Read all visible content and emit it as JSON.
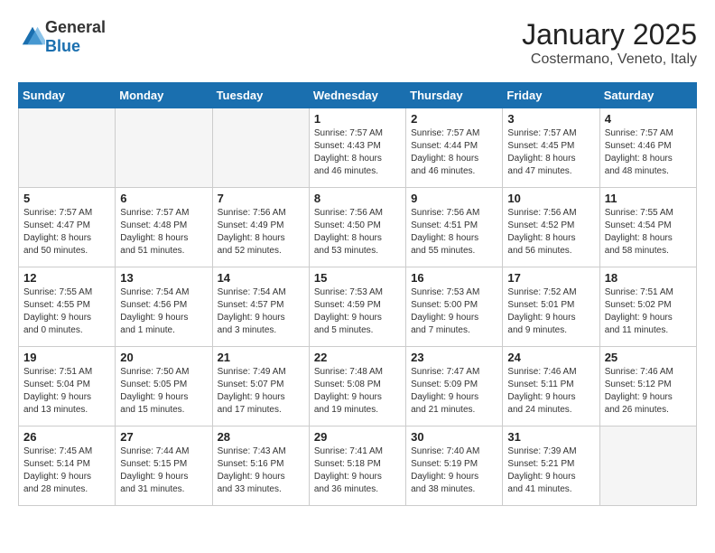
{
  "header": {
    "logo": {
      "general": "General",
      "blue": "Blue"
    },
    "month": "January 2025",
    "location": "Costermano, Veneto, Italy"
  },
  "weekdays": [
    "Sunday",
    "Monday",
    "Tuesday",
    "Wednesday",
    "Thursday",
    "Friday",
    "Saturday"
  ],
  "weeks": [
    [
      {
        "day": "",
        "info": ""
      },
      {
        "day": "",
        "info": ""
      },
      {
        "day": "",
        "info": ""
      },
      {
        "day": "1",
        "info": "Sunrise: 7:57 AM\nSunset: 4:43 PM\nDaylight: 8 hours\nand 46 minutes."
      },
      {
        "day": "2",
        "info": "Sunrise: 7:57 AM\nSunset: 4:44 PM\nDaylight: 8 hours\nand 46 minutes."
      },
      {
        "day": "3",
        "info": "Sunrise: 7:57 AM\nSunset: 4:45 PM\nDaylight: 8 hours\nand 47 minutes."
      },
      {
        "day": "4",
        "info": "Sunrise: 7:57 AM\nSunset: 4:46 PM\nDaylight: 8 hours\nand 48 minutes."
      }
    ],
    [
      {
        "day": "5",
        "info": "Sunrise: 7:57 AM\nSunset: 4:47 PM\nDaylight: 8 hours\nand 50 minutes."
      },
      {
        "day": "6",
        "info": "Sunrise: 7:57 AM\nSunset: 4:48 PM\nDaylight: 8 hours\nand 51 minutes."
      },
      {
        "day": "7",
        "info": "Sunrise: 7:56 AM\nSunset: 4:49 PM\nDaylight: 8 hours\nand 52 minutes."
      },
      {
        "day": "8",
        "info": "Sunrise: 7:56 AM\nSunset: 4:50 PM\nDaylight: 8 hours\nand 53 minutes."
      },
      {
        "day": "9",
        "info": "Sunrise: 7:56 AM\nSunset: 4:51 PM\nDaylight: 8 hours\nand 55 minutes."
      },
      {
        "day": "10",
        "info": "Sunrise: 7:56 AM\nSunset: 4:52 PM\nDaylight: 8 hours\nand 56 minutes."
      },
      {
        "day": "11",
        "info": "Sunrise: 7:55 AM\nSunset: 4:54 PM\nDaylight: 8 hours\nand 58 minutes."
      }
    ],
    [
      {
        "day": "12",
        "info": "Sunrise: 7:55 AM\nSunset: 4:55 PM\nDaylight: 9 hours\nand 0 minutes."
      },
      {
        "day": "13",
        "info": "Sunrise: 7:54 AM\nSunset: 4:56 PM\nDaylight: 9 hours\nand 1 minute."
      },
      {
        "day": "14",
        "info": "Sunrise: 7:54 AM\nSunset: 4:57 PM\nDaylight: 9 hours\nand 3 minutes."
      },
      {
        "day": "15",
        "info": "Sunrise: 7:53 AM\nSunset: 4:59 PM\nDaylight: 9 hours\nand 5 minutes."
      },
      {
        "day": "16",
        "info": "Sunrise: 7:53 AM\nSunset: 5:00 PM\nDaylight: 9 hours\nand 7 minutes."
      },
      {
        "day": "17",
        "info": "Sunrise: 7:52 AM\nSunset: 5:01 PM\nDaylight: 9 hours\nand 9 minutes."
      },
      {
        "day": "18",
        "info": "Sunrise: 7:51 AM\nSunset: 5:02 PM\nDaylight: 9 hours\nand 11 minutes."
      }
    ],
    [
      {
        "day": "19",
        "info": "Sunrise: 7:51 AM\nSunset: 5:04 PM\nDaylight: 9 hours\nand 13 minutes."
      },
      {
        "day": "20",
        "info": "Sunrise: 7:50 AM\nSunset: 5:05 PM\nDaylight: 9 hours\nand 15 minutes."
      },
      {
        "day": "21",
        "info": "Sunrise: 7:49 AM\nSunset: 5:07 PM\nDaylight: 9 hours\nand 17 minutes."
      },
      {
        "day": "22",
        "info": "Sunrise: 7:48 AM\nSunset: 5:08 PM\nDaylight: 9 hours\nand 19 minutes."
      },
      {
        "day": "23",
        "info": "Sunrise: 7:47 AM\nSunset: 5:09 PM\nDaylight: 9 hours\nand 21 minutes."
      },
      {
        "day": "24",
        "info": "Sunrise: 7:46 AM\nSunset: 5:11 PM\nDaylight: 9 hours\nand 24 minutes."
      },
      {
        "day": "25",
        "info": "Sunrise: 7:46 AM\nSunset: 5:12 PM\nDaylight: 9 hours\nand 26 minutes."
      }
    ],
    [
      {
        "day": "26",
        "info": "Sunrise: 7:45 AM\nSunset: 5:14 PM\nDaylight: 9 hours\nand 28 minutes."
      },
      {
        "day": "27",
        "info": "Sunrise: 7:44 AM\nSunset: 5:15 PM\nDaylight: 9 hours\nand 31 minutes."
      },
      {
        "day": "28",
        "info": "Sunrise: 7:43 AM\nSunset: 5:16 PM\nDaylight: 9 hours\nand 33 minutes."
      },
      {
        "day": "29",
        "info": "Sunrise: 7:41 AM\nSunset: 5:18 PM\nDaylight: 9 hours\nand 36 minutes."
      },
      {
        "day": "30",
        "info": "Sunrise: 7:40 AM\nSunset: 5:19 PM\nDaylight: 9 hours\nand 38 minutes."
      },
      {
        "day": "31",
        "info": "Sunrise: 7:39 AM\nSunset: 5:21 PM\nDaylight: 9 hours\nand 41 minutes."
      },
      {
        "day": "",
        "info": ""
      }
    ]
  ]
}
